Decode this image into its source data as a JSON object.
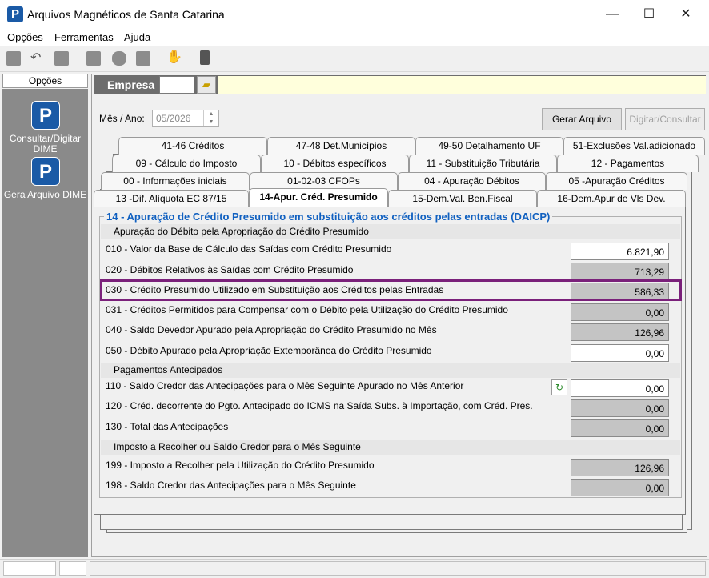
{
  "window": {
    "title": "Arquivos Magnéticos de Santa Catarina",
    "app_icon": "P",
    "minimize": "—",
    "maximize": "☐",
    "close": "✕"
  },
  "menu": [
    "Opções",
    "Ferramentas",
    "Ajuda"
  ],
  "toolbar_icons": [
    "new-icon",
    "undo-icon",
    "stop-icon",
    "document-icon",
    "print-icon",
    "export-icon",
    "handshake-icon",
    "exit-door-icon"
  ],
  "sidebar": {
    "header": "Opções",
    "items": [
      {
        "label": "Consultar/Digitar DIME",
        "icon": "P"
      },
      {
        "label": "Gera Arquivo DIME",
        "icon": "P"
      }
    ]
  },
  "empresa": {
    "label": "Empresa",
    "code": "",
    "name": ""
  },
  "period": {
    "label": "Mês / Ano:",
    "value": "05/2026"
  },
  "buttons": {
    "gerar": "Gerar Arquivo",
    "digitar": "Digitar/Consultar"
  },
  "tabs": {
    "row1": [
      "41-46   Créditos",
      "47-48   Det.Municípios",
      "49-50   Detalhamento UF",
      "51-Exclusões Val.adicionado"
    ],
    "row2": [
      "09 - Cálculo do Imposto",
      "10 - Débitos específicos",
      "11 - Substituição Tributária",
      "12 - Pagamentos"
    ],
    "row3": [
      "00 - Informações iniciais",
      "01-02-03   CFOPs",
      "04 - Apuração Débitos",
      "05 -Apuração Créditos"
    ],
    "row4": [
      "13 -Dif. Alíquota EC 87/15",
      "14-Apur. Créd. Presumido",
      "15-Dem.Val. Ben.Fiscal",
      "16-Dem.Apur de Vls Dev."
    ]
  },
  "section_title": "14 - Apuração de Crédito Presumido em substituição aos créditos pelas entradas (DAICP)",
  "groups": {
    "g1": "Apuração do Débito pela Apropriação do Crédito Presumido",
    "g2": "Pagamentos Antecipados",
    "g3": "Imposto a Recolher ou Saldo Credor para o Mês Seguinte"
  },
  "rows": [
    {
      "label": "010 - Valor da Base de Cálculo das Saídas com Crédito Presumido",
      "value": "6.821,90",
      "editable": true
    },
    {
      "label": "020 - Débitos Relativos às Saídas com Crédito Presumido",
      "value": "713,29",
      "editable": false
    },
    {
      "label": "030 - Crédito Presumido Utilizado em Substituição aos Créditos pelas Entradas",
      "value": "586,33",
      "editable": false
    },
    {
      "label": "031 - Créditos Permitidos para Compensar com o Débito pela Utilização do Crédito Presumido",
      "value": "0,00",
      "editable": false
    },
    {
      "label": "040 - Saldo Devedor Apurado pela Apropriação do Crédito Presumido no Mês",
      "value": "126,96",
      "editable": false
    },
    {
      "label": "050 - Débito Apurado pela Apropriação Extemporânea do Crédito Presumido",
      "value": "0,00",
      "editable": true
    },
    {
      "label": "110 - Saldo Credor das Antecipações para o Mês Seguinte Apurado no Mês Anterior",
      "value": "0,00",
      "editable": true
    },
    {
      "label": "120 - Créd. decorrente do Pgto. Antecipado do ICMS na Saída Subs. à Importação, com Créd. Pres.",
      "value": "0,00",
      "editable": false
    },
    {
      "label": "130 - Total das Antecipações",
      "value": "0,00",
      "editable": false
    },
    {
      "label": "199 - Imposto a Recolher pela Utilização do Crédito Presumido",
      "value": "126,96",
      "editable": false
    },
    {
      "label": "198 - Saldo Credor das Antecipações para o Mês Seguinte",
      "value": "0,00",
      "editable": false
    }
  ],
  "refresh_icon": "↻"
}
